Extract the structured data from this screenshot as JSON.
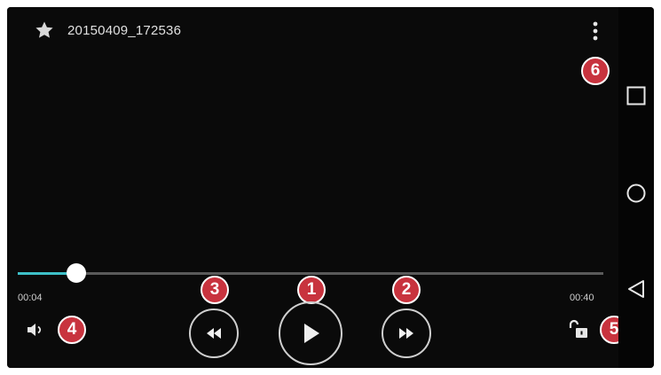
{
  "video": {
    "title": "20150409_172536",
    "elapsed": "00:04",
    "duration": "00:40",
    "progress_fraction": 0.1
  },
  "callouts": {
    "play": "1",
    "fast_forward": "2",
    "rewind": "3",
    "volume": "4",
    "lock": "5",
    "menu": "6"
  },
  "icons": {
    "favorite": "star-icon",
    "menu": "more-vertical-icon",
    "volume": "speaker-icon",
    "lock": "unlock-icon",
    "rewind": "rewind-icon",
    "play": "play-icon",
    "fast_forward": "fast-forward-icon",
    "nav_recents": "square-icon",
    "nav_home": "circle-icon",
    "nav_back": "triangle-back-icon"
  },
  "colors": {
    "background": "#0e0e0e",
    "progress": "#3ec0c8",
    "track": "#5a5a5a",
    "callout": "#c8333e",
    "foreground": "#e0e0e0"
  }
}
